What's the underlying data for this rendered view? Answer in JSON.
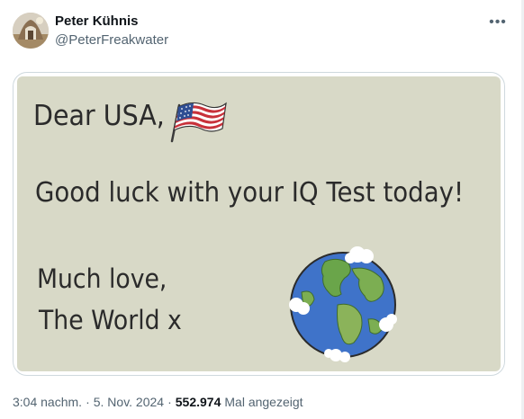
{
  "author": {
    "display_name": "Peter Kühnis",
    "handle": "@PeterFreakwater",
    "avatar_icon": "profile-photo"
  },
  "more_icon": "more-options-icon",
  "media": {
    "line1": "Dear USA,",
    "line2": "Good luck with your IQ Test today!",
    "line3": "Much love,",
    "line4": "The World x",
    "flag_icon": "us-flag",
    "globe_icon": "earth-globe"
  },
  "meta": {
    "time": "3:04 nachm.",
    "separator": "·",
    "date": "5. Nov. 2024",
    "views_count": "552.974",
    "views_label": "Mal angezeigt"
  },
  "colors": {
    "text_primary": "#0f1419",
    "text_secondary": "#536471",
    "card_background": "#d8d9c7"
  }
}
